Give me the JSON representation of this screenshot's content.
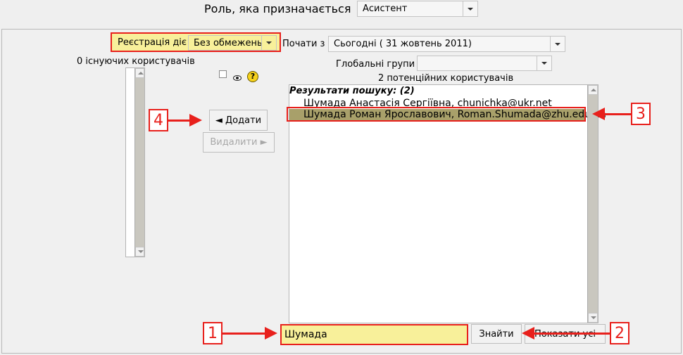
{
  "role": {
    "label": "Роль, яка призначається",
    "selected": "Асистент"
  },
  "enrolment": {
    "label": "Реєстрація діє",
    "duration_selected": "Без обмежень",
    "start_label": "Почати з",
    "start_selected": "Сьогодні ( 31 жовтень 2011)",
    "groups_label": "Глобальні групи",
    "groups_selected": ""
  },
  "existing": {
    "header": "0 існуючих користувачів"
  },
  "icons": {
    "checkbox": "checkbox-icon",
    "eye": "eye-icon",
    "help": "help-icon",
    "help_glyph": "?"
  },
  "actions": {
    "add_label": "◄ Додати",
    "remove_label": "Видалити ►"
  },
  "potential": {
    "header": "2 потенційних користувачів",
    "group_label": "Результати пошуку: (2)",
    "options": [
      "Шумада Анастасія Сергіївна, chunichka@ukr.net",
      "Шумада Роман Ярославович, Roman.Shumada@zhu.edu.ua"
    ],
    "selected_index": 1
  },
  "search": {
    "value": "Шумада",
    "find_label": "Знайти",
    "show_all_label": "Показати усі"
  },
  "callouts": [
    "1",
    "2",
    "3",
    "4"
  ],
  "colors": {
    "callout": "#e8201c",
    "highlight": "#f8f09a",
    "selected_row": "#a8a06a"
  }
}
